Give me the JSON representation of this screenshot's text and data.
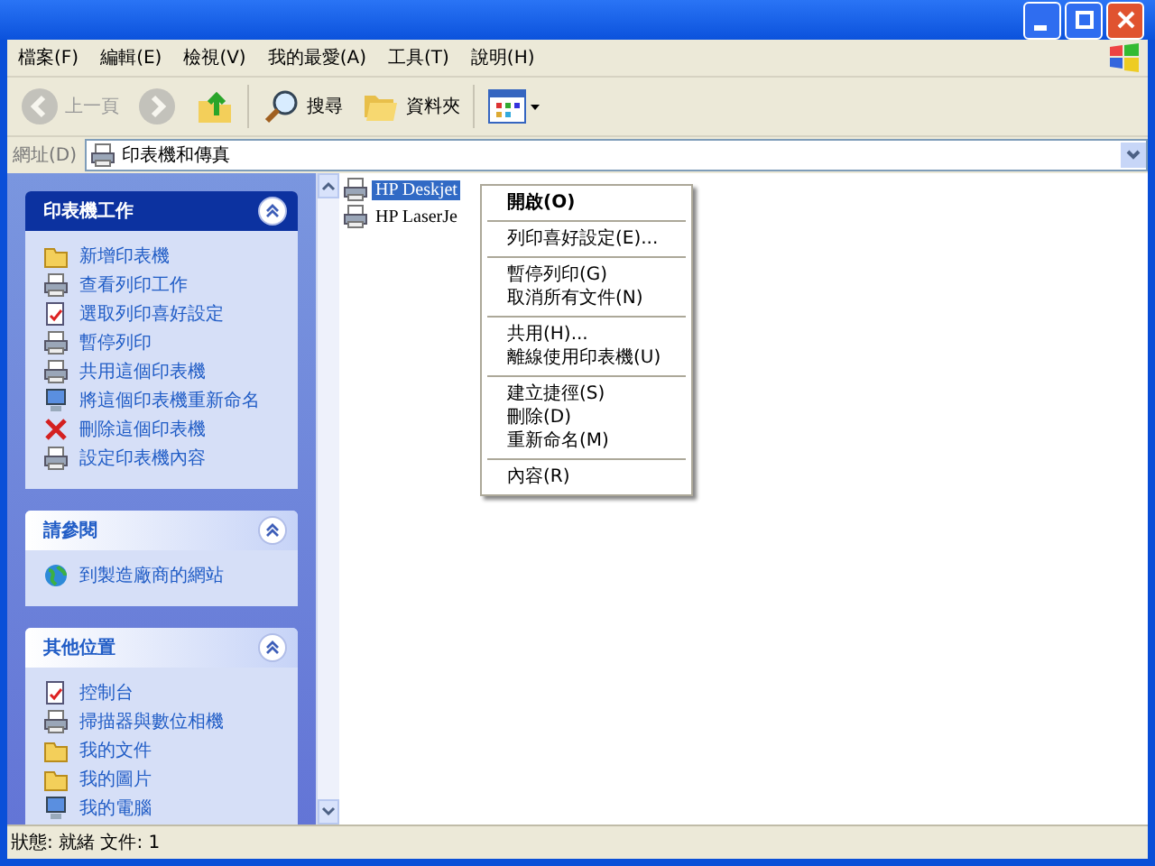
{
  "menu_bar": [
    "檔案(F)",
    "編輯(E)",
    "檢視(V)",
    "我的最愛(A)",
    "工具(T)",
    "說明(H)"
  ],
  "toolbar": [
    {
      "kind": "back",
      "label": "上一頁",
      "disabled": true
    },
    {
      "kind": "forward",
      "disabled": true
    },
    {
      "kind": "up",
      "disabled": false
    },
    {
      "kind": "search",
      "label": "搜尋",
      "disabled": false
    },
    {
      "kind": "folders",
      "label": "資料夾",
      "disabled": false
    },
    {
      "kind": "views",
      "disabled": false
    }
  ],
  "address_bar": {
    "label": "網址(D)",
    "value": "印表機和傳真"
  },
  "sidebar": [
    {
      "title": "印表機工作",
      "expanded": true,
      "items": [
        "新增印表機",
        "查看列印工作",
        "選取列印喜好設定",
        "暫停列印",
        "共用這個印表機",
        "將這個印表機重新命名",
        "刪除這個印表機",
        "設定印表機內容"
      ]
    },
    {
      "title": "請參閱",
      "expanded": true,
      "items": [
        "到製造廠商的網站"
      ]
    },
    {
      "title": "其他位置",
      "expanded": true,
      "items": [
        "控制台",
        "掃描器與數位相機",
        "我的文件",
        "我的圖片",
        "我的電腦"
      ]
    }
  ],
  "files": [
    {
      "name": "HP Deskjet",
      "selected": true
    },
    {
      "name": "HP LaserJe",
      "selected": false
    }
  ],
  "context_menu": [
    [
      {
        "label": "開啟(O)",
        "default": true
      }
    ],
    [
      {
        "label": "列印喜好設定(E)...",
        "default": false
      }
    ],
    [
      {
        "label": "暫停列印(G)",
        "default": false
      },
      {
        "label": "取消所有文件(N)",
        "default": false
      }
    ],
    [
      {
        "label": "共用(H)...",
        "default": false
      },
      {
        "label": "離線使用印表機(U)",
        "default": false
      }
    ],
    [
      {
        "label": "建立捷徑(S)",
        "default": false
      },
      {
        "label": "刪除(D)",
        "default": false
      },
      {
        "label": "重新命名(M)",
        "default": false
      }
    ],
    [
      {
        "label": "內容(R)",
        "default": false
      }
    ]
  ],
  "status_bar": "狀態: 就緒 文件: 1"
}
